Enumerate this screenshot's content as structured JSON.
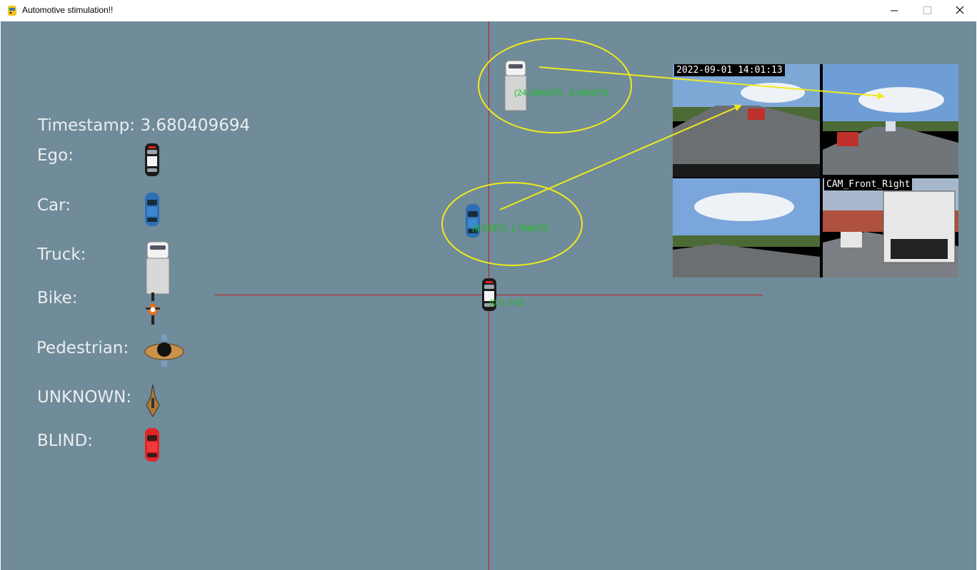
{
  "window": {
    "title": "Automotive stimulation!!",
    "buttons": {
      "minimize": "—",
      "maximize": "☐",
      "close": "✕"
    }
  },
  "simulation": {
    "timestamp_label": "Timestamp: 3.680409694"
  },
  "legend": [
    {
      "label": "Ego:",
      "icon": "ego-car-icon"
    },
    {
      "label": "Car:",
      "icon": "car-icon"
    },
    {
      "label": "Truck:",
      "icon": "truck-icon"
    },
    {
      "label": "Bike:",
      "icon": "bike-icon"
    },
    {
      "label": "Pedestrian:",
      "icon": "pedestrian-icon"
    },
    {
      "label": "UNKNOWN:",
      "icon": "unknown-object-icon"
    },
    {
      "label": "BLIND:",
      "icon": "blind-car-icon"
    }
  ],
  "objects": [
    {
      "type": "truck",
      "coords": "(24.3984375, -3.046875)"
    },
    {
      "type": "car",
      "coords": "(8.59375, 1.796875)"
    },
    {
      "type": "ego",
      "coords": "(0.0, 0.0)"
    }
  ],
  "cameras": [
    {
      "label": "2022-09-01 14:01:13"
    },
    {
      "label": ""
    },
    {
      "label": ""
    },
    {
      "label": "CAM_Front_Right"
    }
  ],
  "colors": {
    "background": "#708b99",
    "axis": "#b22222",
    "highlight": "#f0ea1c",
    "coords_text": "#17c21a",
    "label_text": "#eaeef1"
  }
}
